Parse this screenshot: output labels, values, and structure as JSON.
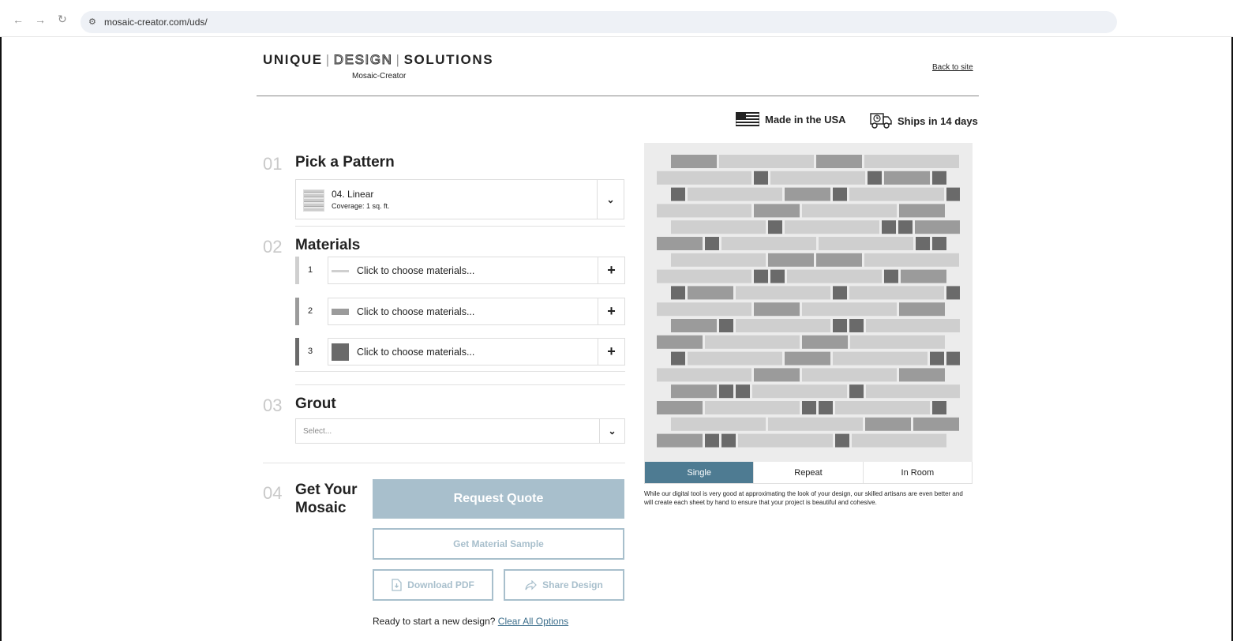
{
  "browser": {
    "url": "mosaic-creator.com/uds/",
    "back_icon": "arrow-left-icon",
    "forward_icon": "arrow-right-icon",
    "reload_icon": "reload-icon"
  },
  "header": {
    "brand_word_1": "UNIQUE",
    "brand_word_2": "DESIGN",
    "brand_word_3": "SOLUTIONS",
    "brand_separator": "|",
    "subtitle": "Mosaic-Creator",
    "back_link": "Back to site"
  },
  "badges": {
    "usa": "Made in the USA",
    "ships": "Ships in 14 days"
  },
  "sections": {
    "pattern": {
      "number": "01",
      "title": "Pick a Pattern",
      "selected_name": "04. Linear",
      "coverage": "Coverage: 1 sq. ft."
    },
    "materials": {
      "number": "02",
      "title": "Materials",
      "rows": [
        {
          "index": "1",
          "label": "Click to choose materials...",
          "color": "#cfcfcf"
        },
        {
          "index": "2",
          "label": "Click to choose materials...",
          "color": "#9b9b9b"
        },
        {
          "index": "3",
          "label": "Click to choose materials...",
          "color": "#6a6a6a"
        }
      ]
    },
    "grout": {
      "number": "03",
      "title": "Grout",
      "placeholder": "Select..."
    },
    "get": {
      "number": "04",
      "title_line_1": "Get Your",
      "title_line_2": "Mosaic",
      "request_quote": "Request Quote",
      "material_sample": "Get Material Sample",
      "download_pdf": "Download PDF",
      "share_design": "Share Design",
      "new_design_text": "Ready to start a new design?",
      "clear_all": "Clear All Options"
    }
  },
  "preview": {
    "tabs": [
      "Single",
      "Repeat",
      "In Room"
    ],
    "active_tab": "Single",
    "disclaimer": "While our digital tool is very good at approximating the look of your design, our skilled artisans are even better and will create each sheet by hand to ensure that your project is beautiful and cohesive."
  },
  "colors": {
    "accent": "#4e7b92",
    "button_muted": "#a8bfcc",
    "tile_light": "#cfcfcf",
    "tile_mid": "#9b9b9b",
    "tile_dark": "#6a6a6a"
  }
}
